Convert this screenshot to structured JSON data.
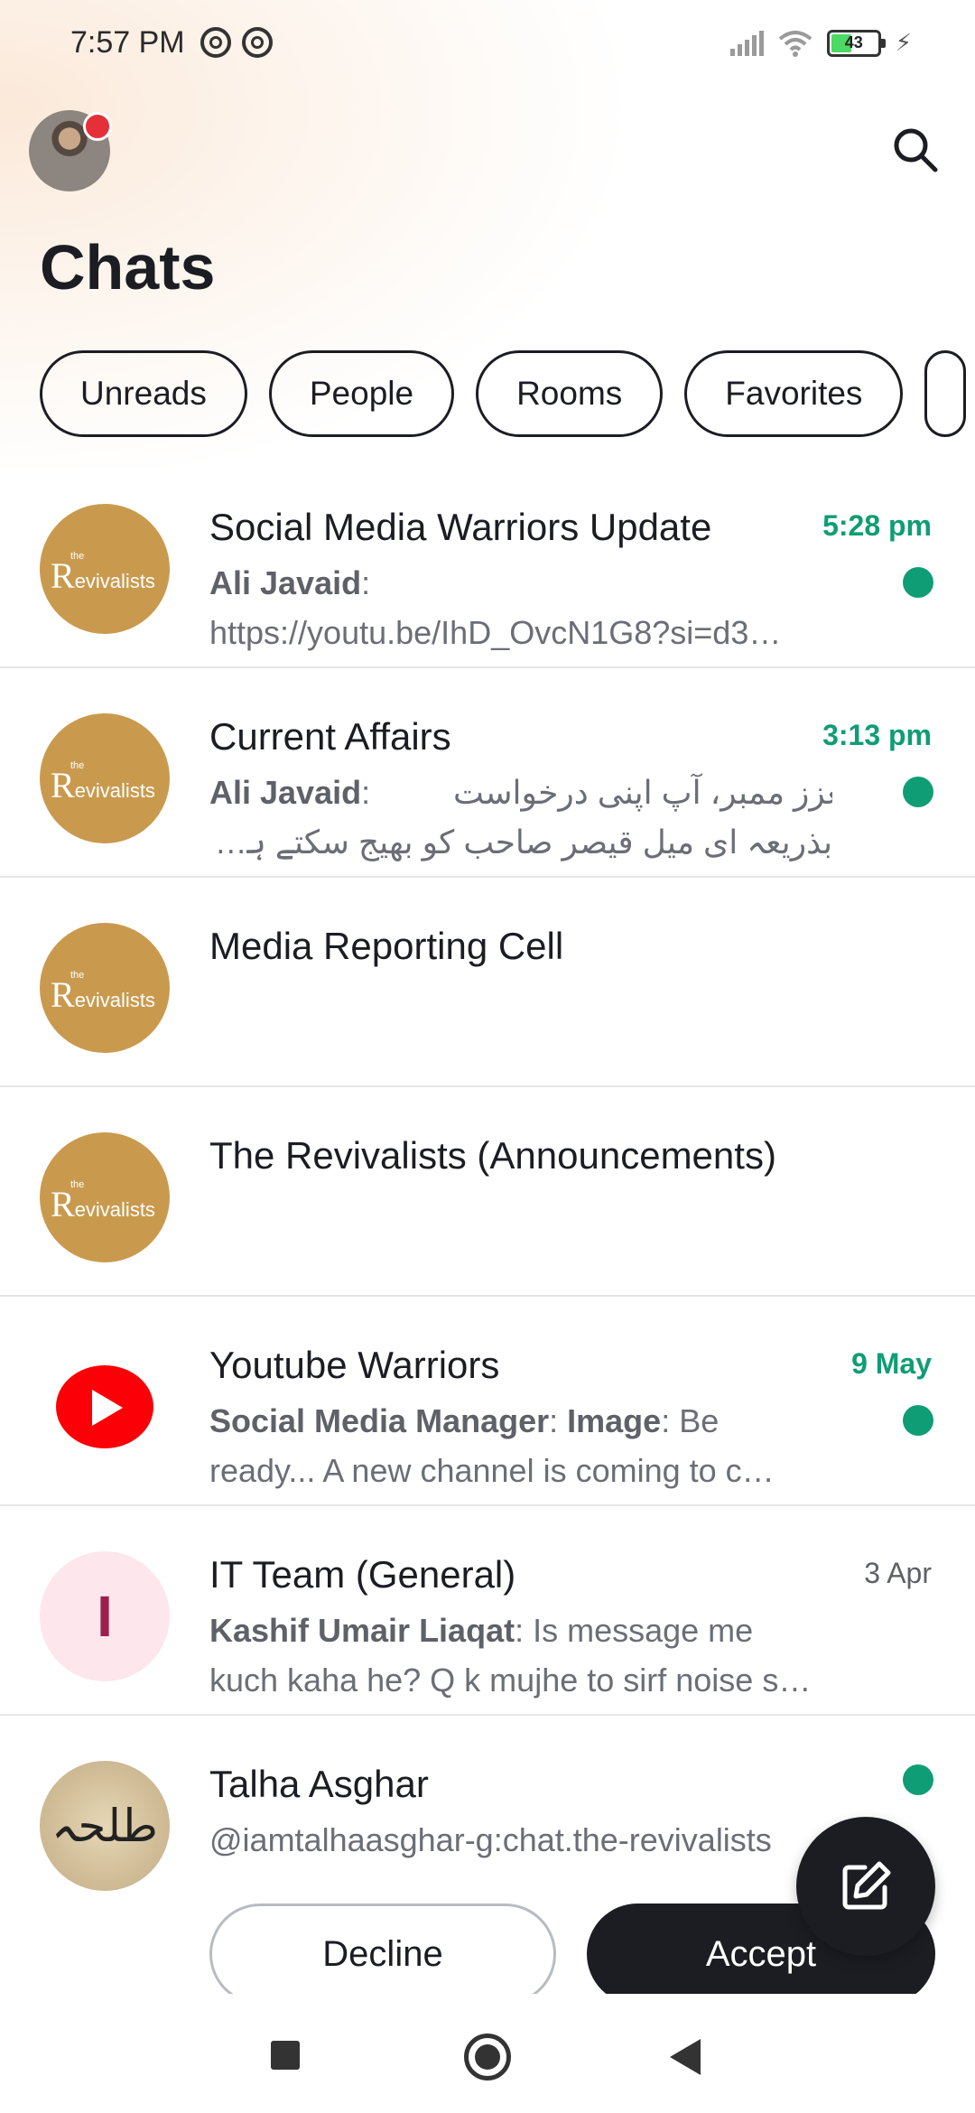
{
  "status_bar": {
    "time": "7:57 PM",
    "battery": "43",
    "battery_level": 0.43,
    "icons": [
      "at-icon",
      "at-icon",
      "signal-icon",
      "wifi-icon",
      "battery-icon",
      "charging-icon"
    ]
  },
  "header": {
    "title": "Chats",
    "avatar_icon": "profile-avatar",
    "search_icon": "search-icon"
  },
  "filters": [
    "Unreads",
    "People",
    "Rooms",
    "Favorites"
  ],
  "chats": [
    {
      "name": "Social Media Warriors Update",
      "time": "5:28 pm",
      "sender": "Ali Javaid",
      "message": "https://youtu.be/IhD_OvcN1G8?si=d3…",
      "unread": true
    },
    {
      "name": "Current Affairs",
      "time": "3:13 pm",
      "sender": "Ali Javaid",
      "message": "معزز ممبر، آپ اپنی درخواست",
      "message2": "بذریعہ ای میل قیصر صاحب کو بھیج سکتے ہیں…",
      "unread": true
    },
    {
      "name": "Media Reporting Cell"
    },
    {
      "name": "The Revivalists (Announcements)"
    },
    {
      "name": "Youtube Warriors",
      "time": "9 May",
      "sender": "Social Media Manager",
      "tag": "Image",
      "message": ": Be",
      "message2": "ready... A new channel is coming to c…",
      "unread": true
    },
    {
      "name": "IT Team (General)",
      "time": "3 Apr",
      "sender": "Kashif Umair Liaqat",
      "message": ": Is message me",
      "message2": "kuch kaha he? Q k mujhe to sirf noise s…",
      "avatar_letter": "I"
    },
    {
      "name": "Talha Asghar",
      "handle": "@iamtalhaasghar-g:chat.the-revivalists",
      "unread": true,
      "avatar_text": "طلحہ"
    }
  ],
  "revivalists_logo": {
    "pre": "the",
    "r": "R",
    "rest": "evivalists"
  },
  "invite": {
    "decline": "Decline",
    "accept": "Accept"
  },
  "colors": {
    "accent": "#0f9d75",
    "dark": "#1b1d22",
    "youtube_red": "#fb0007",
    "revivalists_gold": "#c99a4e"
  }
}
